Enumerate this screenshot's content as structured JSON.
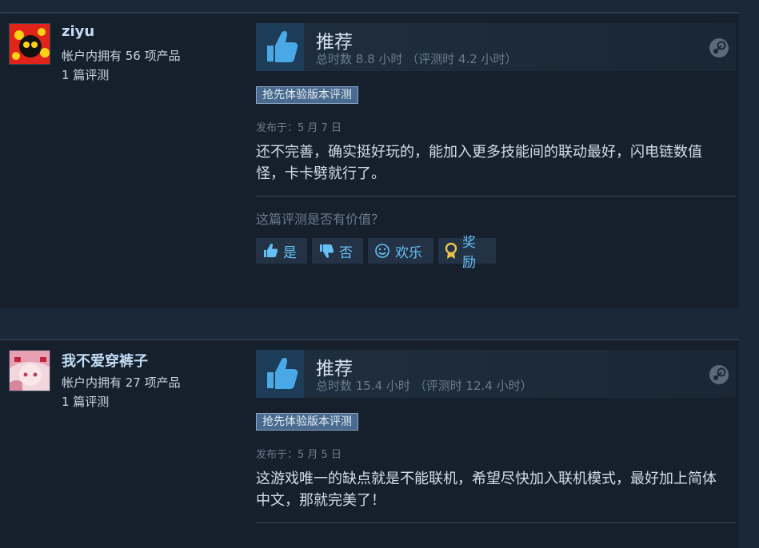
{
  "reviews": [
    {
      "username": "ziyu",
      "products": "帐户内拥有 56 项产品",
      "review_count": "1 篇评测",
      "verdict": "推荐",
      "hours": "总时数 8.8 小时 （评测时 4.2 小时）",
      "badge": "抢先体验版本评测",
      "posted": "发布于：5 月 7 日",
      "text": "还不完善，确实挺好玩的，能加入更多技能间的联动最好，闪电链数值怪，卡卡劈就行了。",
      "helpful_question": "这篇评测是否有价值？",
      "buttons": {
        "yes": "是",
        "no": "否",
        "funny": "欢乐",
        "award": "奖励"
      }
    },
    {
      "username": "我不爱穿裤子",
      "products": "帐户内拥有 27 项产品",
      "review_count": "1 篇评测",
      "verdict": "推荐",
      "hours": "总时数 15.4 小时 （评测时 12.4 小时）",
      "badge": "抢先体验版本评测",
      "posted": "发布于：5 月 5 日",
      "text": "这游戏唯一的缺点就是不能联机，希望尽快加入联机模式，最好加上简体中文，那就完美了！"
    }
  ],
  "colors": {
    "background": "#1b2838",
    "card": "#16202d",
    "link_blue": "#66c0f4",
    "thumb_blue": "#4aa8e6",
    "award_gold": "#e8c24a"
  },
  "icons": [
    "thumbs-up-icon",
    "steam-logo-icon",
    "thumbs-up-small-icon",
    "thumbs-down-small-icon",
    "smiley-icon",
    "award-icon"
  ]
}
